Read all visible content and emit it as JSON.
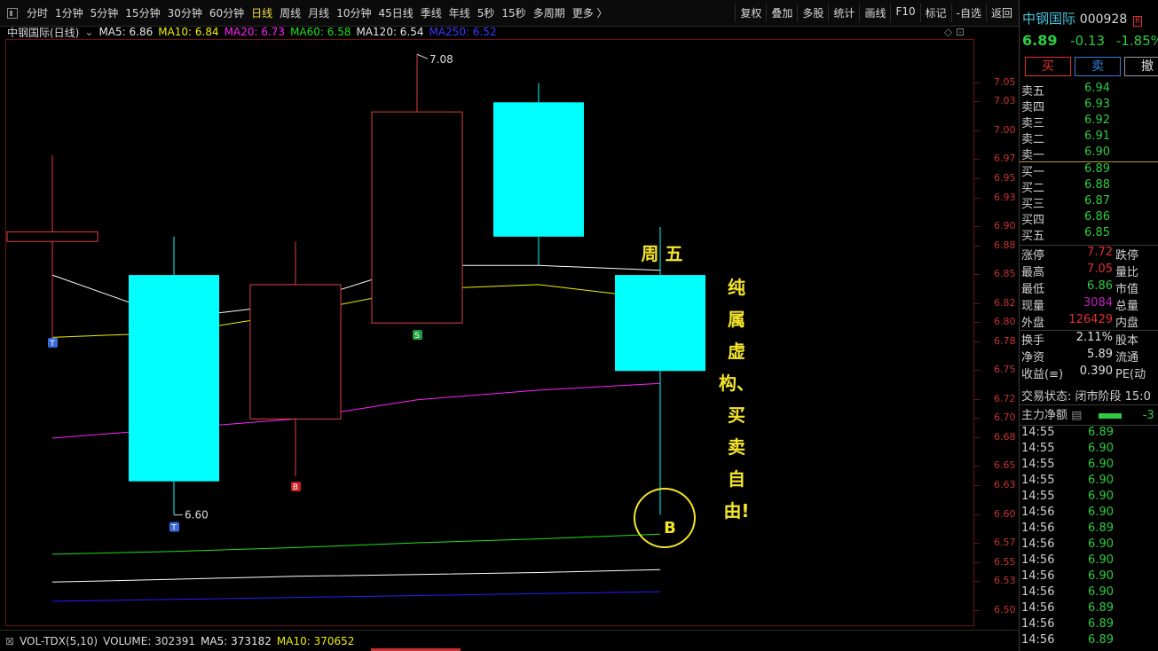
{
  "toolbar": {
    "periods": [
      "分时",
      "1分钟",
      "5分钟",
      "15分钟",
      "30分钟",
      "60分钟",
      "日线",
      "周线",
      "月线",
      "10分钟",
      "45日线",
      "季线",
      "年线",
      "5秒",
      "15秒",
      "多周期",
      "更多 〉"
    ],
    "active_period": "日线",
    "right_items": [
      "复权",
      "叠加",
      "多股",
      "统计",
      "画线",
      "F10",
      "标记",
      "-自选",
      "返回"
    ]
  },
  "chart_header": {
    "title": "中钢国际(日线)",
    "ma5": "MA5: 6.86",
    "ma10": "MA10: 6.84",
    "ma20": "MA20: 6.73",
    "ma60": "MA60: 6.58",
    "ma120": "MA120: 6.54",
    "ma250": "MA250: 6.52"
  },
  "colors": {
    "up": "#e04040",
    "down": "#00ffff",
    "ma5": "#ffffff",
    "ma10": "#f0f000",
    "ma20": "#ff20ff",
    "ma60": "#20e020",
    "ma120": "#ffffff",
    "ma250": "#2020ff",
    "annotation": "#f5e52a"
  },
  "chart_data": {
    "type": "candlestick",
    "ylim": [
      6.485,
      7.095
    ],
    "yticks": [
      "7.05",
      "7.03",
      "7.00",
      "6.97",
      "6.95",
      "6.93",
      "6.90",
      "6.88",
      "6.85",
      "6.82",
      "6.80",
      "6.78",
      "6.75",
      "6.72",
      "6.70",
      "6.68",
      "6.65",
      "6.63",
      "6.60",
      "6.57",
      "6.55",
      "6.53",
      "6.50"
    ],
    "candles": [
      {
        "open": 6.895,
        "close": 6.885,
        "high": 6.975,
        "low": 6.785,
        "dir": "up"
      },
      {
        "open": 6.85,
        "close": 6.635,
        "high": 6.89,
        "low": 6.6,
        "dir": "down"
      },
      {
        "open": 6.7,
        "close": 6.84,
        "high": 6.885,
        "low": 6.64,
        "dir": "up"
      },
      {
        "open": 6.8,
        "close": 7.02,
        "high": 7.08,
        "low": 6.8,
        "dir": "up"
      },
      {
        "open": 7.03,
        "close": 6.89,
        "high": 7.05,
        "low": 6.86,
        "dir": "down"
      },
      {
        "open": 6.85,
        "close": 6.75,
        "high": 6.9,
        "low": 6.6,
        "dir": "down"
      }
    ],
    "ma_lines": {
      "ma5": [
        6.85,
        6.805,
        6.82,
        6.86,
        6.86,
        6.855
      ],
      "ma10": [
        6.785,
        6.79,
        6.81,
        6.835,
        6.84,
        6.825
      ],
      "ma20": [
        6.68,
        6.69,
        6.7,
        6.72,
        6.73,
        6.737
      ],
      "ma60": [
        6.559,
        6.562,
        6.566,
        6.571,
        6.575,
        6.58
      ],
      "ma120": [
        6.53,
        6.533,
        6.536,
        6.538,
        6.54,
        6.543
      ],
      "ma250": [
        6.51,
        6.512,
        6.514,
        6.516,
        6.518,
        6.52
      ]
    },
    "high_label": "7.08",
    "low_label": "6.60",
    "markers": [
      {
        "candle": 0,
        "text": "T",
        "price": 6.78,
        "color": "#3a6ad8"
      },
      {
        "candle": 1,
        "text": "T",
        "price": 6.588,
        "color": "#3a6ad8"
      },
      {
        "candle": 2,
        "text": "B",
        "price": 6.63,
        "color": "#c82020"
      },
      {
        "candle": 3,
        "text": "S",
        "price": 6.788,
        "color": "#20a040"
      }
    ]
  },
  "annotations": {
    "friday": "周 五",
    "circle_b": "B",
    "vertical_text": [
      "纯",
      "属",
      "虚",
      "构、",
      "买",
      "卖",
      "自",
      "由!"
    ]
  },
  "volume_bar": {
    "label": "VOL-TDX(5,10)",
    "volume": "VOLUME: 302391",
    "ma5": "MA5: 373182",
    "ma10": "MA10: 370652"
  },
  "right_panel": {
    "name": "中钢国际",
    "code": "000928",
    "badge": "R",
    "price": "6.89",
    "change": "-0.13",
    "pct": "-1.85%",
    "buttons": [
      "买",
      "卖",
      "撤"
    ],
    "asks": [
      {
        "label": "卖五",
        "price": "6.94"
      },
      {
        "label": "卖四",
        "price": "6.93"
      },
      {
        "label": "卖三",
        "price": "6.92"
      },
      {
        "label": "卖二",
        "price": "6.91"
      },
      {
        "label": "卖一",
        "price": "6.90"
      }
    ],
    "bids": [
      {
        "label": "买一",
        "price": "6.89"
      },
      {
        "label": "买二",
        "price": "6.88"
      },
      {
        "label": "买三",
        "price": "6.87"
      },
      {
        "label": "买四",
        "price": "6.86"
      },
      {
        "label": "买五",
        "price": "6.85"
      }
    ],
    "stats1": [
      {
        "label": "涨停",
        "value": "7.72",
        "color": "#e03030",
        "label2": "跌停"
      },
      {
        "label": "最高",
        "value": "7.05",
        "color": "#e03030",
        "label2": "量比"
      },
      {
        "label": "最低",
        "value": "6.86",
        "color": "#2ecc40",
        "label2": "市值"
      },
      {
        "label": "现量",
        "value": "3084",
        "color": "#c020c0",
        "label2": "总量"
      },
      {
        "label": "外盘",
        "value": "126429",
        "color": "#e03030",
        "label2": "内盘"
      }
    ],
    "stats2": [
      {
        "label": "换手",
        "value": "2.11%",
        "color": "#e0e0e0",
        "label2": "股本"
      },
      {
        "label": "净资",
        "value": "5.89",
        "color": "#e0e0e0",
        "label2": "流通"
      },
      {
        "label": "收益(≡)",
        "value": "0.390",
        "color": "#e0e0e0",
        "label2": "PE(动"
      }
    ],
    "trade_status": "交易状态: 闭市阶段 15:0",
    "main_flow": "主力净额",
    "main_flow_value": "-3",
    "ticks": [
      {
        "time": "14:55",
        "price": "6.89"
      },
      {
        "time": "14:55",
        "price": "6.90"
      },
      {
        "time": "14:55",
        "price": "6.90"
      },
      {
        "time": "14:55",
        "price": "6.90"
      },
      {
        "time": "14:55",
        "price": "6.90"
      },
      {
        "time": "14:56",
        "price": "6.90"
      },
      {
        "time": "14:56",
        "price": "6.89"
      },
      {
        "time": "14:56",
        "price": "6.90"
      },
      {
        "time": "14:56",
        "price": "6.90"
      },
      {
        "time": "14:56",
        "price": "6.90"
      },
      {
        "time": "14:56",
        "price": "6.90"
      },
      {
        "time": "14:56",
        "price": "6.89"
      },
      {
        "time": "14:56",
        "price": "6.89"
      },
      {
        "time": "14:56",
        "price": "6.89"
      }
    ]
  }
}
